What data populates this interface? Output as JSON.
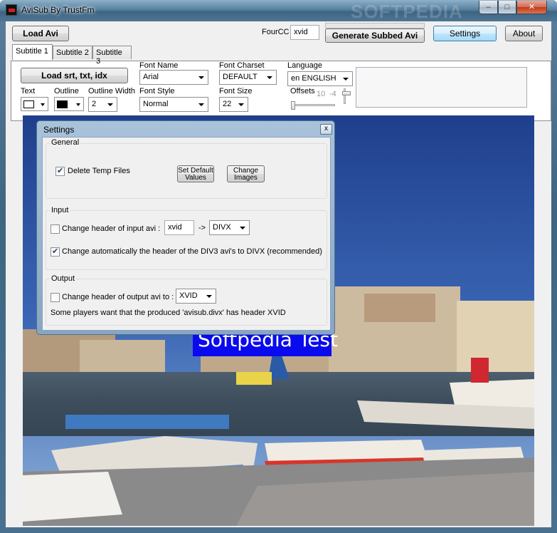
{
  "window": {
    "title": "AviSub By TrustFm",
    "watermark": "SOFTPEDIA",
    "controls": {
      "minimize": "–",
      "maximize": "□",
      "close": "✕"
    }
  },
  "toolbar": {
    "load_avi": "Load Avi",
    "fourcc_label": "FourCC",
    "fourcc_value": "xvid",
    "generate": "Generate Subbed Avi",
    "settings": "Settings",
    "about": "About"
  },
  "tabs": [
    {
      "label": "Subtitle 1",
      "active": true
    },
    {
      "label": "Subtitle 2",
      "active": false
    },
    {
      "label": "Subtitle 3",
      "active": false
    }
  ],
  "subtitle_panel": {
    "load_srt": "Load srt, txt, idx",
    "text_label": "Text",
    "outline_label": "Outline",
    "outline_width_label": "Outline Width",
    "outline_width_value": "2",
    "font_name_label": "Font Name",
    "font_name_value": "Arial",
    "font_style_label": "Font Style",
    "font_style_value": "Normal",
    "font_charset_label": "Font Charset",
    "font_charset_value": "DEFAULT",
    "font_size_label": "Font Size",
    "font_size_value": "22",
    "language_label": "Language",
    "language_value": "en ENGLISH",
    "offsets_label": "Offsets",
    "offset_x": "10",
    "offset_y": "-4",
    "colors": {
      "text": "#ffffff",
      "outline": "#000000"
    }
  },
  "preview": {
    "subtitle_text": "Softpedia Test",
    "subtitle_bg": "#0a0aee"
  },
  "settings_dialog": {
    "title": "Settings",
    "close": "x",
    "general": {
      "title": "General",
      "delete_temp": "Delete Temp Files",
      "delete_temp_checked": true,
      "set_default": "Set Default Values",
      "change_images": "Change Images"
    },
    "input": {
      "title": "Input",
      "change_header": "Change header of input avi :",
      "change_header_checked": false,
      "from_value": "xvid",
      "arrow": "->",
      "to_value": "DIVX",
      "auto_change": "Change automatically the header of the DIV3 avi's to DIVX (recommended)",
      "auto_change_checked": true
    },
    "output": {
      "title": "Output",
      "change_header": "Change header of output avi to :",
      "change_header_checked": false,
      "value": "XVID",
      "note": "Some players want that the produced 'avisub.divx' has header XVID"
    }
  }
}
